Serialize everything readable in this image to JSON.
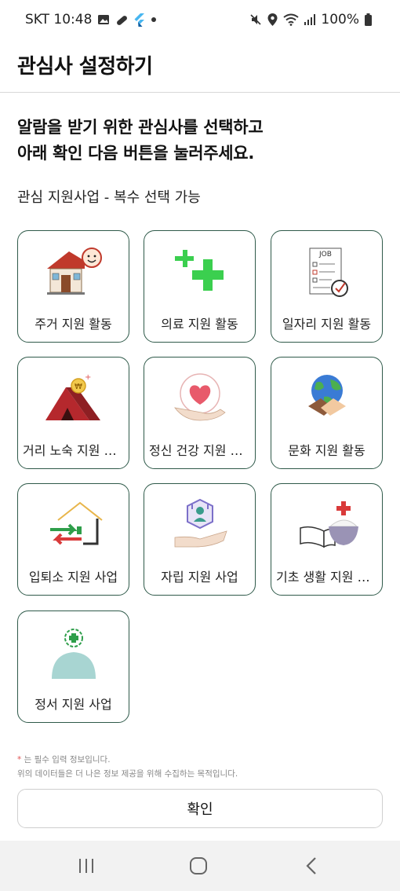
{
  "status_bar": {
    "carrier_time": "SKT 10:48",
    "battery": "100%"
  },
  "header": {
    "title": "관심사 설정하기"
  },
  "instruction": {
    "line1": "알람을 받기 위한 관심사를 선택하고",
    "line2": "아래 확인 다음 버튼을 눌러주세요."
  },
  "subtitle": "관심 지원사업 - 복수 선택 가능",
  "categories": [
    {
      "label": "주거 지원 활동",
      "icon": "house-icon"
    },
    {
      "label": "의료 지원 활동",
      "icon": "medical-cross-icon"
    },
    {
      "label": "일자리 지원 활동",
      "icon": "job-checklist-icon"
    },
    {
      "label": "거리 노숙 지원 활동",
      "icon": "tent-icon"
    },
    {
      "label": "정신 건강 지원 활동",
      "icon": "heart-hand-icon"
    },
    {
      "label": "문화 지원 활동",
      "icon": "globe-handshake-icon"
    },
    {
      "label": "입퇴소 지원 사업",
      "icon": "in-out-house-icon"
    },
    {
      "label": "자립 지원 사업",
      "icon": "self-reliance-icon"
    },
    {
      "label": "기초 생활 지원 사업",
      "icon": "book-rice-icon"
    },
    {
      "label": "정서 지원 사업",
      "icon": "emotional-support-icon"
    }
  ],
  "note": {
    "required_mark": "*",
    "line1": " 는 필수 입력 정보입니다.",
    "line2": "위의 데이터들은 더 나은 정보 제공을 위해 수집하는 목적입니다."
  },
  "confirm_button": "확인"
}
